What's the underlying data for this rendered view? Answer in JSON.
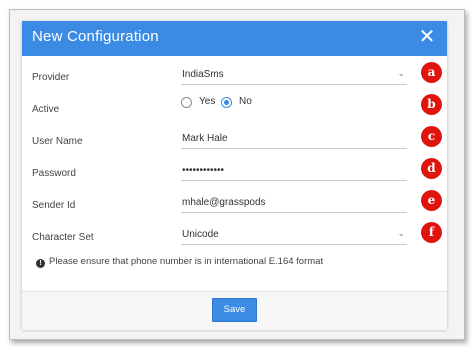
{
  "dialog": {
    "title": "New Configuration",
    "close_icon": "close-icon"
  },
  "form": {
    "provider": {
      "label": "Provider",
      "value": "IndiaSms",
      "badge": "a"
    },
    "active": {
      "label": "Active",
      "options": [
        {
          "label": "Yes",
          "selected": false
        },
        {
          "label": "No",
          "selected": true
        }
      ],
      "badge": "b"
    },
    "user_name": {
      "label": "User Name",
      "value": "Mark Hale",
      "badge": "c"
    },
    "password": {
      "label": "Password",
      "value": "••••••••••••",
      "badge": "d"
    },
    "sender_id": {
      "label": "Sender Id",
      "value": "mhale@grasspods",
      "badge": "e"
    },
    "character_set": {
      "label": "Character Set",
      "value": "Unicode",
      "badge": "f"
    }
  },
  "note": {
    "icon": "info-icon",
    "text": "Please ensure that phone number is in international E.164 format"
  },
  "footer": {
    "save_label": "Save"
  },
  "colors": {
    "header": "#3b8be5",
    "badge": "#e0140f"
  }
}
